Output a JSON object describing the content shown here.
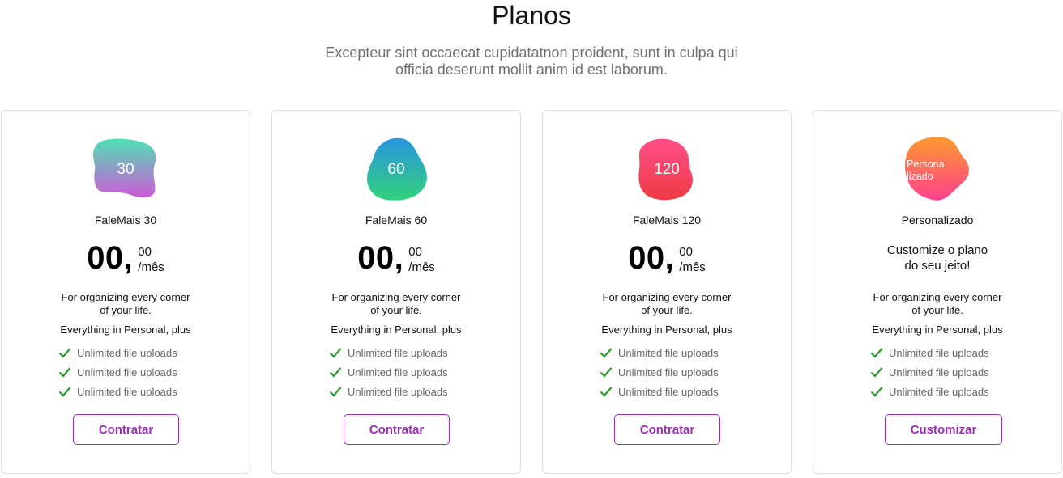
{
  "header": {
    "title": "Planos",
    "subtitle_line1": "Excepteur sint occaecat cupidatatnon proident, sunt in culpa qui",
    "subtitle_line2": "officia deserunt mollit anim id est laborum."
  },
  "colors": {
    "accent": "#9a2fb8",
    "check": "#2f9b2f",
    "border": "#dedede",
    "muted_text": "#6f6f6f"
  },
  "plans": [
    {
      "badge": "30",
      "name": "FaleMais 30",
      "price_main": "00,",
      "price_cents": "00",
      "price_period": "/mês",
      "desc_line1": "For organizing every corner",
      "desc_line2": "of your life.",
      "includes": "Everything in Personal, plus",
      "features": [
        "Unlimited file uploads",
        "Unlimited file uploads",
        "Unlimited file uploads"
      ],
      "cta": "Contratar",
      "gradient": [
        "#4fe0b5",
        "#cc5ad6"
      ]
    },
    {
      "badge": "60",
      "name": "FaleMais 60",
      "price_main": "00,",
      "price_cents": "00",
      "price_period": "/mês",
      "desc_line1": "For organizing every corner",
      "desc_line2": "of your life.",
      "includes": "Everything in Personal, plus",
      "features": [
        "Unlimited file uploads",
        "Unlimited file uploads",
        "Unlimited file uploads"
      ],
      "cta": "Contratar",
      "gradient": [
        "#2796e0",
        "#33d17a"
      ]
    },
    {
      "badge": "120",
      "name": "FaleMais 120",
      "price_main": "00,",
      "price_cents": "00",
      "price_period": "/mês",
      "desc_line1": "For organizing every corner",
      "desc_line2": "of your life.",
      "includes": "Everything in Personal, plus",
      "features": [
        "Unlimited file uploads",
        "Unlimited file uploads",
        "Unlimited file uploads"
      ],
      "cta": "Contratar",
      "gradient": [
        "#ff4f8a",
        "#ee3b43"
      ]
    },
    {
      "badge": "Persona\nlizado",
      "name": "Personalizado",
      "headline_line1": "Customize o plano",
      "headline_line2": "do seu jeito!",
      "desc_line1": "For organizing every corner",
      "desc_line2": "of your life.",
      "includes": "Everything in Personal, plus",
      "features": [
        "Unlimited file uploads",
        "Unlimited file uploads",
        "Unlimited file uploads"
      ],
      "cta": "Customizar",
      "gradient": [
        "#ff9a2e",
        "#ff3f8f"
      ]
    }
  ]
}
